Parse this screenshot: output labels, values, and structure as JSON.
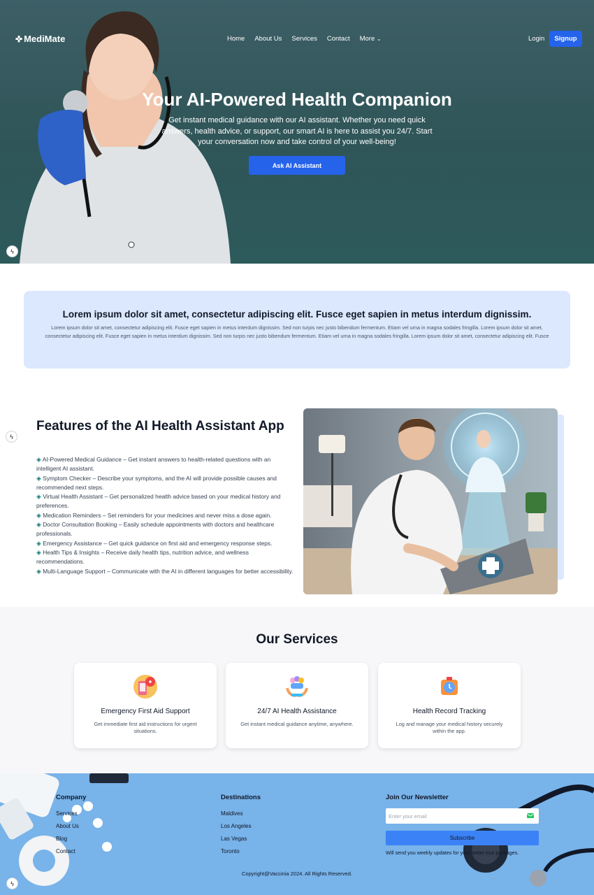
{
  "nav": {
    "logo": "MediMate",
    "logo_icon": "medical-cross-icon",
    "items": [
      "Home",
      "About Us",
      "Services",
      "Contact"
    ],
    "more": "More",
    "login": "Login",
    "signup": "Signup"
  },
  "hero": {
    "title": "Your AI-Powered Health Companion",
    "subtitle": "Get instant medical guidance with our AI assistant. Whether you need quick answers, health advice, or support, our smart AI is here to assist you 24/7. Start your conversation now and take control of your well-being!",
    "cta": "Ask AI Assistant"
  },
  "info": {
    "title": "Lorem ipsum dolor sit amet, consectetur adipiscing elit. Fusce eget sapien in metus interdum dignissim.",
    "body": "Lorem ipsum dolor sit amet, consectetur adipiscing elit. Fusce eget sapien in metus interdum dignissim. Sed non turpis nec justo bibendum fermentum. Etiam vel urna in magna sodales fringilla. Lorem ipsum dolor sit amet, consectetur adipiscing elit. Fusce eget sapien in metus interdum dignissim. Sed non turpis nec justo bibendum fermentum. Etiam vel urna in magna sodales fringilla. Lorem ipsum dolor sit amet, consectetur adipiscing elit. Fusce"
  },
  "features": {
    "title": "Features of the AI Health Assistant App",
    "items": [
      "AI-Powered Medical Guidance – Get instant answers to health-related questions with an intelligent AI assistant.",
      "Symptom Checker – Describe your symptoms, and the AI will provide possible causes and recommended next steps.",
      "Virtual Health Assistant – Get personalized health advice based on your medical history and preferences.",
      "Medication Reminders – Set reminders for your medicines and never miss a dose again.",
      "Doctor Consultation Booking – Easily schedule appointments with doctors and healthcare professionals.",
      "Emergency Assistance – Get quick guidance on first aid and emergency response steps.",
      "Health Tips & Insights – Receive daily health tips, nutrition advice, and wellness recommendations.",
      "Multi-Language Support – Communicate with the AI in different languages for better accessibility."
    ]
  },
  "services": {
    "title": "Our Services",
    "cards": [
      {
        "icon": "first-aid-phone-icon",
        "title": "Emergency First Aid Support",
        "desc": "Get immediate first aid instructions for urgent situations."
      },
      {
        "icon": "ai-assistance-icon",
        "title": "24/7 AI Health Assistance",
        "desc": "Get instant medical guidance anytime, anywhere."
      },
      {
        "icon": "health-record-icon",
        "title": "Health Record Tracking",
        "desc": "Log and manage your medical history securely within the app."
      }
    ]
  },
  "footer": {
    "company_title": "Company",
    "company_links": [
      "Services",
      "About Us",
      "Blog",
      "Contact"
    ],
    "destinations_title": "Destinations",
    "destinations_links": [
      "Maldives",
      "Los Angeles",
      "Las Vegas",
      "Toronto"
    ],
    "newsletter_title": "Join Our Newsletter",
    "email_placeholder": "Enter your email",
    "subscribe": "Subscribe",
    "note": "Will send you weekly updates for your better tour packages.",
    "copyright": "Copyright@Vaccinia 2024. All Rights Reserved."
  },
  "colors": {
    "accent": "#2563eb",
    "hero_bg": "#2f5558",
    "info_bg": "#dbe8fe",
    "footer_bg": "#78b3ea"
  }
}
